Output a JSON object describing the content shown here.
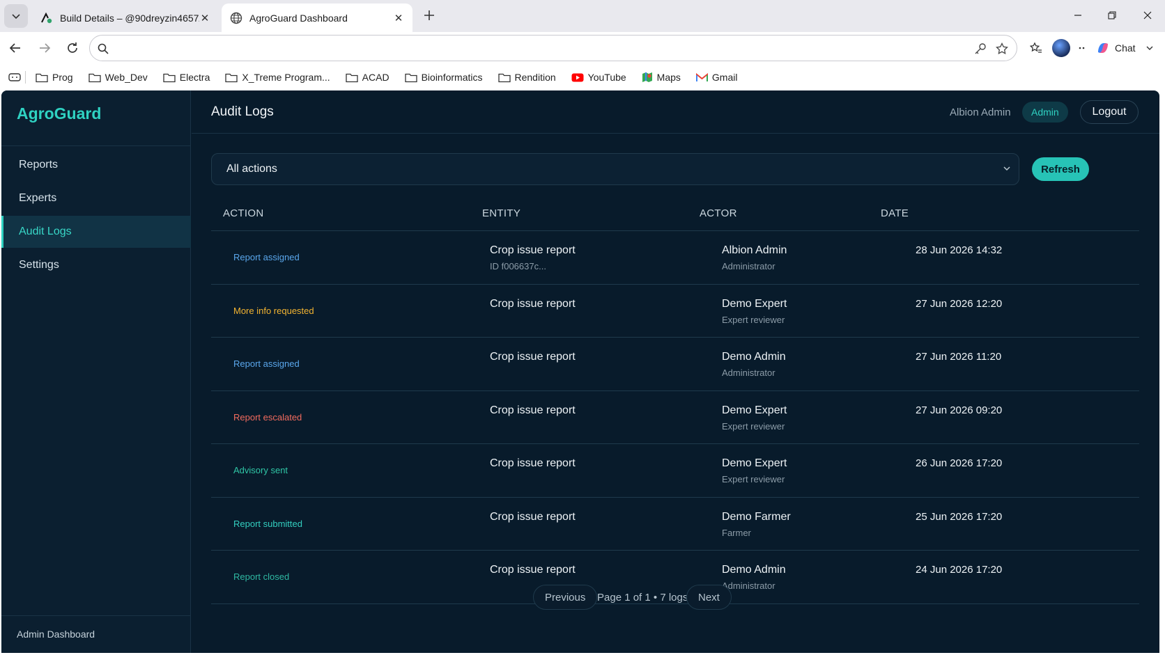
{
  "browser": {
    "tabs": [
      {
        "title": "Build Details – @90dreyzin4657/",
        "active": false
      },
      {
        "title": "AgroGuard Dashboard",
        "active": true
      }
    ],
    "address": "",
    "chat_label": "Chat",
    "bookmarks": [
      "Prog",
      "Web_Dev",
      "Electra",
      "X_Treme Program...",
      "ACAD",
      "Bioinformatics",
      "Rendition",
      "YouTube",
      "Maps",
      "Gmail"
    ]
  },
  "app": {
    "brand": "AgroGuard",
    "nav": [
      "Reports",
      "Experts",
      "Audit Logs",
      "Settings"
    ],
    "active_nav": "Audit Logs",
    "footer": "Admin Dashboard",
    "header": {
      "title": "Audit Logs",
      "user": "Albion Admin",
      "role": "Admin",
      "logout": "Logout"
    },
    "filter": {
      "selected": "All actions"
    },
    "refresh": "Refresh",
    "columns": [
      "ACTION",
      "ENTITY",
      "ACTOR",
      "DATE"
    ],
    "rows": [
      {
        "action": "Report assigned",
        "color": "#5aa7ec",
        "entity": "Crop issue report",
        "entity_sub": "ID f006637c...",
        "actor": "Albion Admin",
        "actor_role": "Administrator",
        "date": "28 Jun 2026 14:32"
      },
      {
        "action": "More info requested",
        "color": "#f3b431",
        "entity": "Crop issue report",
        "entity_sub": "",
        "actor": "Demo Expert",
        "actor_role": "Expert reviewer",
        "date": "27 Jun 2026 12:20"
      },
      {
        "action": "Report assigned",
        "color": "#5aa7ec",
        "entity": "Crop issue report",
        "entity_sub": "",
        "actor": "Demo Admin",
        "actor_role": "Administrator",
        "date": "27 Jun 2026 11:20"
      },
      {
        "action": "Report escalated",
        "color": "#f26b5e",
        "entity": "Crop issue report",
        "entity_sub": "",
        "actor": "Demo Expert",
        "actor_role": "Expert reviewer",
        "date": "27 Jun 2026 09:20"
      },
      {
        "action": "Advisory sent",
        "color": "#2fc6a6",
        "entity": "Crop issue report",
        "entity_sub": "",
        "actor": "Demo Expert",
        "actor_role": "Expert reviewer",
        "date": "26 Jun 2026 17:20"
      },
      {
        "action": "Report submitted",
        "color": "#33cfc0",
        "entity": "Crop issue report",
        "entity_sub": "",
        "actor": "Demo Farmer",
        "actor_role": "Farmer",
        "date": "25 Jun 2026 17:20"
      },
      {
        "action": "Report closed",
        "color": "#2fb9a3",
        "entity": "Crop issue report",
        "entity_sub": "",
        "actor": "Demo Admin",
        "actor_role": "Administrator",
        "date": "24 Jun 2026 17:20"
      }
    ],
    "pagination": {
      "previous": "Previous",
      "info": "Page 1 of 1 • 7 logs",
      "next": "Next"
    }
  }
}
